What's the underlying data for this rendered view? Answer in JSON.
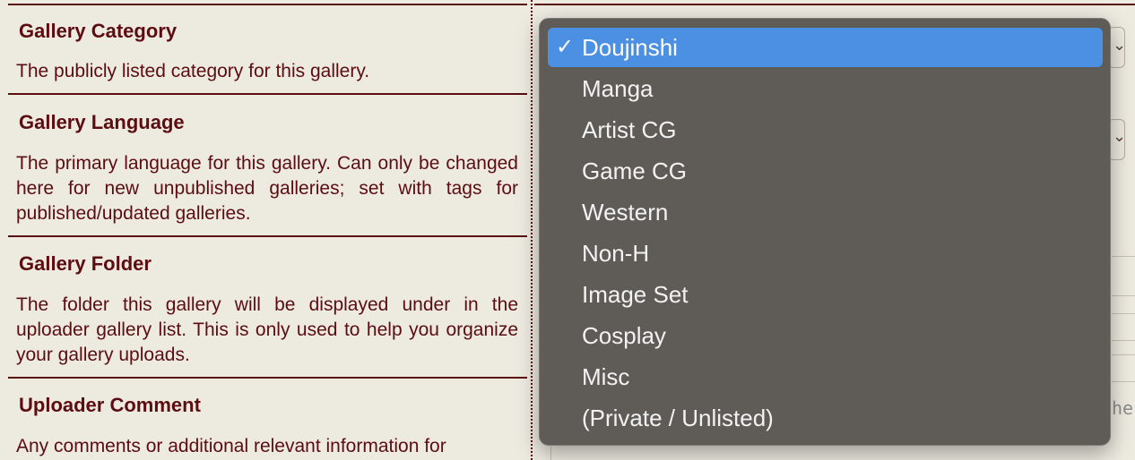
{
  "sections": [
    {
      "title": "Gallery Category",
      "description": "The publicly listed category for this gallery."
    },
    {
      "title": "Gallery Language",
      "description": "The primary language for this gallery. Can only be changed here for new unpublished galleries; set with tags for published/updated galleries."
    },
    {
      "title": "Gallery Folder",
      "description": "The folder this gallery will be displayed under in the uploader gallery list. This is only used to help you organize your gallery uploads."
    },
    {
      "title": "Uploader Comment",
      "description": "Any comments or additional relevant information for"
    }
  ],
  "category_dropdown": {
    "selected_check": "✓",
    "options": [
      "Doujinshi",
      "Manga",
      "Artist CG",
      "Game CG",
      "Western",
      "Non-H",
      "Image Set",
      "Cosplay",
      "Misc",
      "(Private / Unlisted)"
    ],
    "selected": "Doujinshi"
  },
  "partial_text": "he",
  "colors": {
    "background": "#edeae0",
    "text": "#5c0d11",
    "menu_bg": "#5f5c57",
    "menu_highlight": "#4b90e2"
  }
}
